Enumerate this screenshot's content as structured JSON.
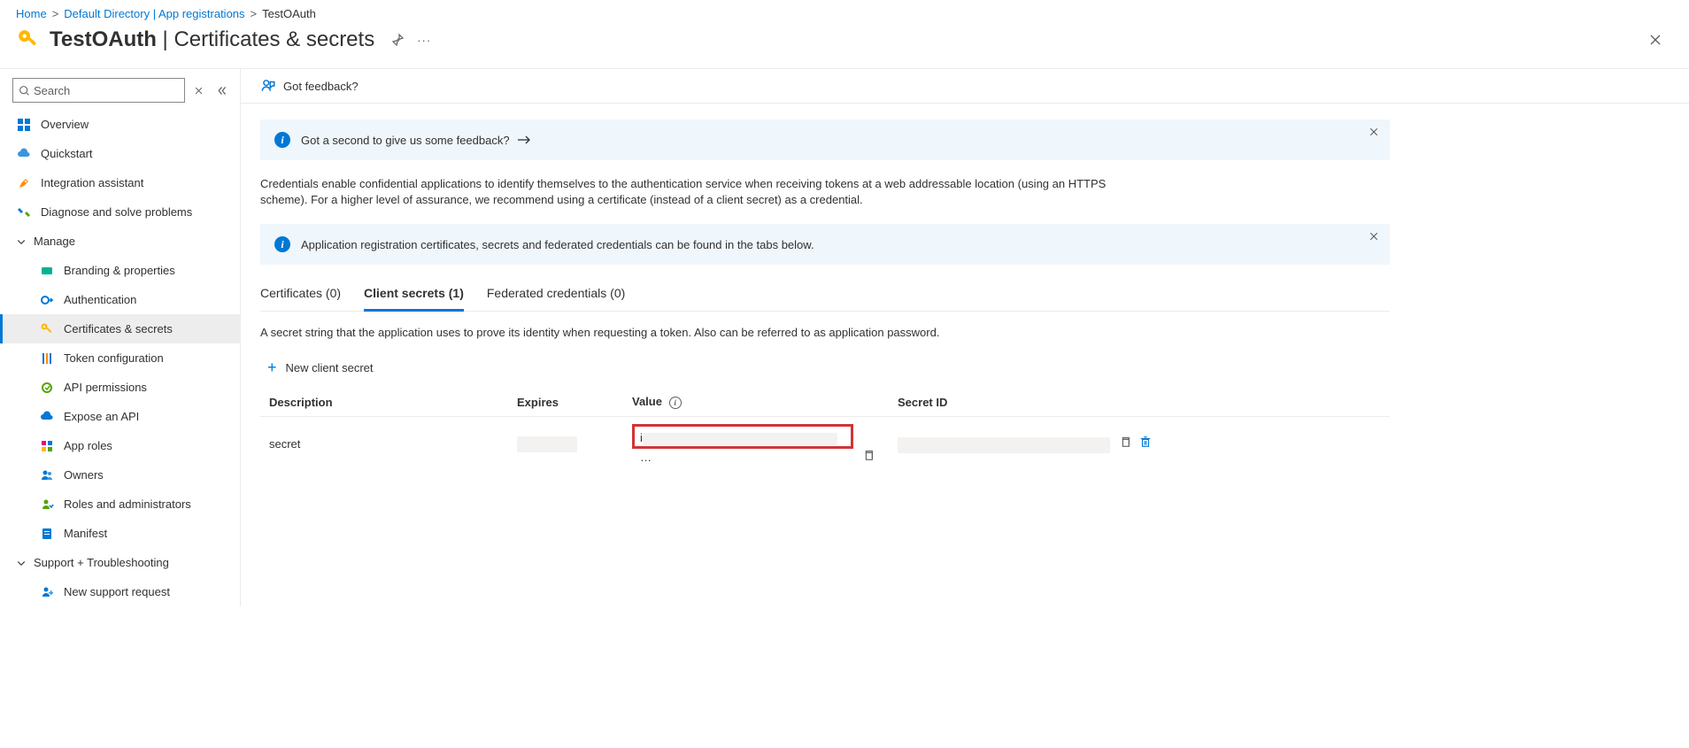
{
  "breadcrumb": {
    "home": "Home",
    "directory": "Default Directory | App registrations",
    "current": "TestOAuth"
  },
  "header": {
    "title_strong": "TestOAuth",
    "title_rest": " | Certificates & secrets"
  },
  "search": {
    "placeholder": "Search"
  },
  "sidebar": {
    "overview": "Overview",
    "quickstart": "Quickstart",
    "integration": "Integration assistant",
    "diagnose": "Diagnose and solve problems",
    "manage": "Manage",
    "branding": "Branding & properties",
    "auth": "Authentication",
    "certs": "Certificates & secrets",
    "token": "Token configuration",
    "api_perm": "API permissions",
    "expose": "Expose an API",
    "approles": "App roles",
    "owners": "Owners",
    "roles": "Roles and administrators",
    "manifest": "Manifest",
    "support": "Support + Troubleshooting",
    "newsupport": "New support request"
  },
  "toolbar": {
    "feedback": "Got feedback?"
  },
  "banners": {
    "feedback_prompt": "Got a second to give us some feedback?",
    "tabs_info": "Application registration certificates, secrets and federated credentials can be found in the tabs below."
  },
  "description": "Credentials enable confidential applications to identify themselves to the authentication service when receiving tokens at a web addressable location (using an HTTPS scheme). For a higher level of assurance, we recommend using a certificate (instead of a client secret) as a credential.",
  "tabs": {
    "certificates": "Certificates (0)",
    "client_secrets": "Client secrets (1)",
    "federated": "Federated credentials (0)"
  },
  "tab_description": "A secret string that the application uses to prove its identity when requesting a token. Also can be referred to as application password.",
  "new_secret": "New client secret",
  "table": {
    "headers": {
      "description": "Description",
      "expires": "Expires",
      "value": "Value",
      "secret_id": "Secret ID"
    },
    "row": {
      "description": "secret",
      "value_trail": "…"
    }
  }
}
